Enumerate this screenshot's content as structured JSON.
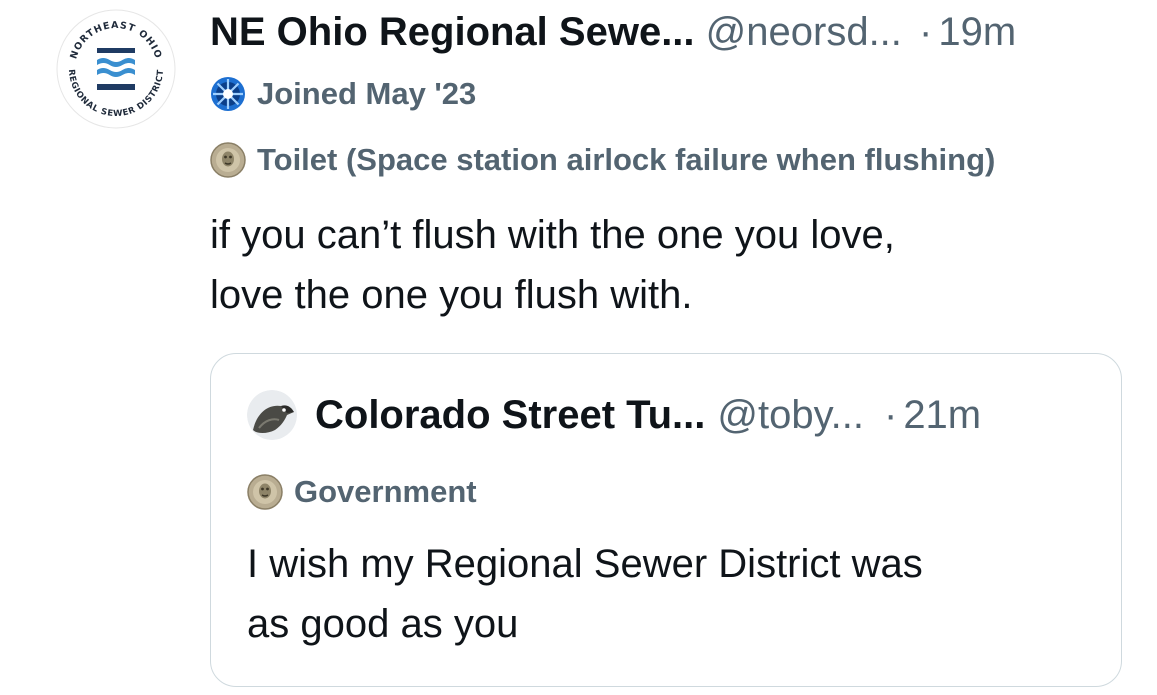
{
  "post": {
    "author_name": "NE Ohio Regional Sewe...",
    "handle": "@neorsd...",
    "separator": "·",
    "time": "19m",
    "joined": "Joined May '23",
    "tag": "Toilet (Space station airlock failure when flushing)",
    "body_lines": [
      "if you can’t flush with the one you love,",
      "love the one you flush with."
    ],
    "avatar_icon": "sewer-district-logo-icon",
    "avatar_logo_text_top": "NORTHEAST OHIO",
    "avatar_logo_text_bottom": "REGIONAL SEWER DISTRICT"
  },
  "quote": {
    "author_name": "Colorado Street Tu...",
    "handle": "@toby...",
    "separator": "·",
    "time": "21m",
    "tag": "Government",
    "body_lines": [
      "I wish my Regional Sewer District was",
      "as good as you"
    ],
    "avatar_icon": "bird-avatar-icon"
  },
  "colors": {
    "text_primary": "#0f1419",
    "text_secondary": "#536471",
    "border": "#cfd9de",
    "logo_blue": "#2f7fc1",
    "logo_navy": "#1f3b63"
  }
}
